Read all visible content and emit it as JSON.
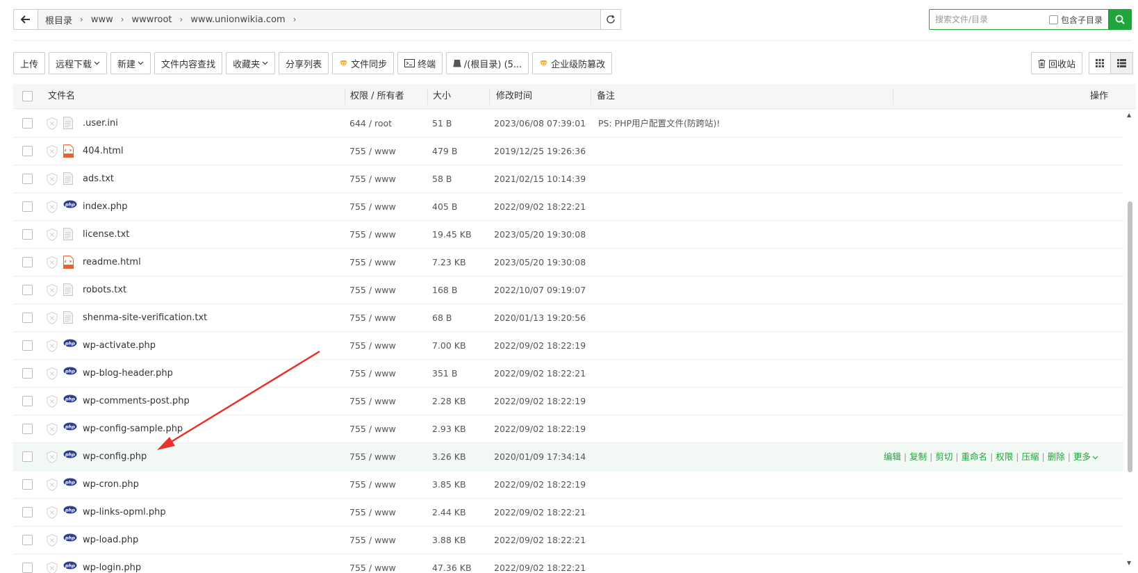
{
  "path": {
    "crumbs": [
      "根目录",
      "www",
      "wwwroot",
      "www.unionwikia.com"
    ]
  },
  "search": {
    "placeholder": "搜索文件/目录",
    "include_sub_label": "包含子目录"
  },
  "toolbar": {
    "upload": "上传",
    "remote_download": "远程下载",
    "new": "新建",
    "content_search": "文件内容查找",
    "favorites": "收藏夹",
    "share_list": "分享列表",
    "file_sync": "文件同步",
    "terminal": "终端",
    "disk": "/(根目录) (5...",
    "tamper_proof": "企业级防篡改",
    "recycle": "回收站"
  },
  "table": {
    "headers": {
      "name": "文件名",
      "perm": "权限 / 所有者",
      "size": "大小",
      "mtime": "修改时间",
      "note": "备注",
      "ops": "操作"
    },
    "rows": [
      {
        "icon": "txt-file-icon",
        "name": ".user.ini",
        "perm": "644 / root",
        "size": "51 B",
        "mtime": "2023/06/08 07:39:01",
        "note": "PS: PHP用户配置文件(防跨站)!"
      },
      {
        "icon": "html-file-icon",
        "name": "404.html",
        "perm": "755 / www",
        "size": "479 B",
        "mtime": "2019/12/25 19:26:36",
        "note": ""
      },
      {
        "icon": "txt-file-icon",
        "name": "ads.txt",
        "perm": "755 / www",
        "size": "58 B",
        "mtime": "2021/02/15 10:14:39",
        "note": ""
      },
      {
        "icon": "php-file-icon",
        "name": "index.php",
        "perm": "755 / www",
        "size": "405 B",
        "mtime": "2022/09/02 18:22:21",
        "note": ""
      },
      {
        "icon": "txt-file-icon",
        "name": "license.txt",
        "perm": "755 / www",
        "size": "19.45 KB",
        "mtime": "2023/05/20 19:30:08",
        "note": ""
      },
      {
        "icon": "html-file-icon",
        "name": "readme.html",
        "perm": "755 / www",
        "size": "7.23 KB",
        "mtime": "2023/05/20 19:30:08",
        "note": ""
      },
      {
        "icon": "txt-file-icon",
        "name": "robots.txt",
        "perm": "755 / www",
        "size": "168 B",
        "mtime": "2022/10/07 09:19:07",
        "note": ""
      },
      {
        "icon": "txt-file-icon",
        "name": "shenma-site-verification.txt",
        "perm": "755 / www",
        "size": "68 B",
        "mtime": "2020/01/13 19:20:56",
        "note": ""
      },
      {
        "icon": "php-file-icon",
        "name": "wp-activate.php",
        "perm": "755 / www",
        "size": "7.00 KB",
        "mtime": "2022/09/02 18:22:19",
        "note": ""
      },
      {
        "icon": "php-file-icon",
        "name": "wp-blog-header.php",
        "perm": "755 / www",
        "size": "351 B",
        "mtime": "2022/09/02 18:22:21",
        "note": ""
      },
      {
        "icon": "php-file-icon",
        "name": "wp-comments-post.php",
        "perm": "755 / www",
        "size": "2.28 KB",
        "mtime": "2022/09/02 18:22:19",
        "note": ""
      },
      {
        "icon": "php-file-icon",
        "name": "wp-config-sample.php",
        "perm": "755 / www",
        "size": "2.93 KB",
        "mtime": "2022/09/02 18:22:19",
        "note": ""
      },
      {
        "icon": "php-file-icon",
        "name": "wp-config.php",
        "perm": "755 / www",
        "size": "3.26 KB",
        "mtime": "2020/01/09 17:34:14",
        "note": "",
        "highlighted": true
      },
      {
        "icon": "php-file-icon",
        "name": "wp-cron.php",
        "perm": "755 / www",
        "size": "3.85 KB",
        "mtime": "2022/09/02 18:22:19",
        "note": ""
      },
      {
        "icon": "php-file-icon",
        "name": "wp-links-opml.php",
        "perm": "755 / www",
        "size": "2.44 KB",
        "mtime": "2022/09/02 18:22:21",
        "note": ""
      },
      {
        "icon": "php-file-icon",
        "name": "wp-load.php",
        "perm": "755 / www",
        "size": "3.88 KB",
        "mtime": "2022/09/02 18:22:21",
        "note": ""
      },
      {
        "icon": "php-file-icon",
        "name": "wp-login.php",
        "perm": "755 / www",
        "size": "47.36 KB",
        "mtime": "2022/09/02 18:22:21",
        "note": ""
      }
    ],
    "row_actions": [
      "编辑",
      "复制",
      "剪切",
      "重命名",
      "权限",
      "压缩",
      "删除",
      "更多"
    ]
  },
  "colors": {
    "accent": "#20a53a",
    "annotation_arrow": "#e8322d",
    "php_icon": "#2d3e8f",
    "html_icon": "#e4662d"
  }
}
